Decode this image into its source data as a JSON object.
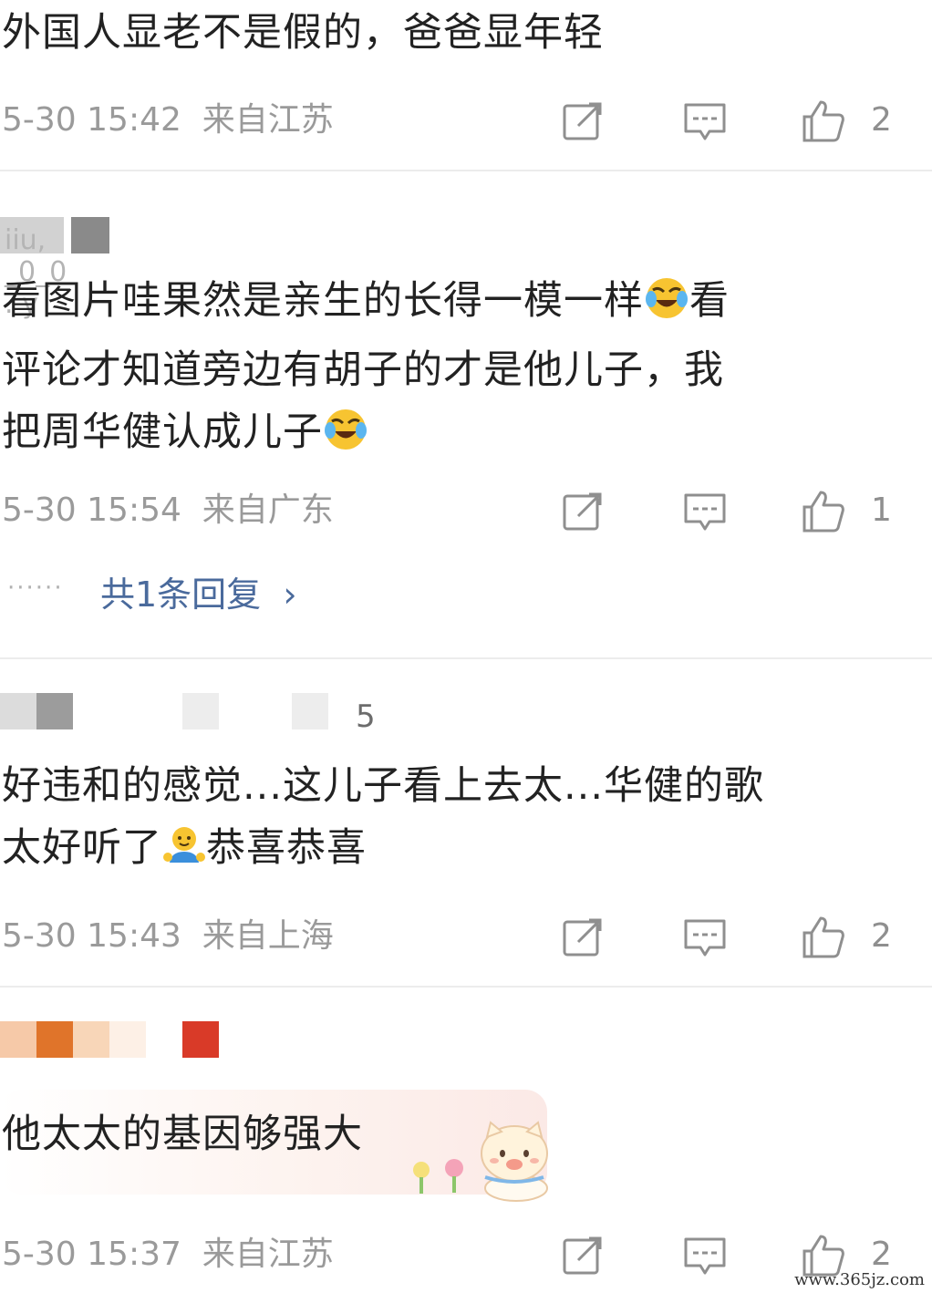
{
  "comments": [
    {
      "text": "外国人显老不是假的，爸爸显年轻",
      "time": "5-30 15:42",
      "location": "来自江苏",
      "likes": "2",
      "actions": [
        "share-icon",
        "comment-icon",
        "like-icon"
      ]
    },
    {
      "username_fragment": "iiu, _0_0 . y",
      "text_lines": [
        "看图片哇果然是亲生的长得一模一样",
        "看",
        "评论才知道旁边有胡子的才是他儿子，我",
        "把周华健认成儿子"
      ],
      "time": "5-30 15:54",
      "location": "来自广东",
      "likes": "1",
      "replies_dots": "······",
      "replies_label": "共1条回复",
      "replies_chevron": "›"
    },
    {
      "username_fragment": "5",
      "text_lines": [
        "好违和的感觉...这儿子看上去太...华健的歌",
        "太好听了",
        "恭喜恭喜"
      ],
      "time": "5-30 15:43",
      "location": "来自上海",
      "likes": "2"
    },
    {
      "text": "他太太的基因够强大",
      "time": "5-30 15:37",
      "location": "来自江苏",
      "likes": "2"
    }
  ],
  "watermark": "www.365jz.com",
  "colors": {
    "meta_gray": "#9a9a9a",
    "link_blue": "#4a6a9c",
    "divider": "#ececec"
  }
}
